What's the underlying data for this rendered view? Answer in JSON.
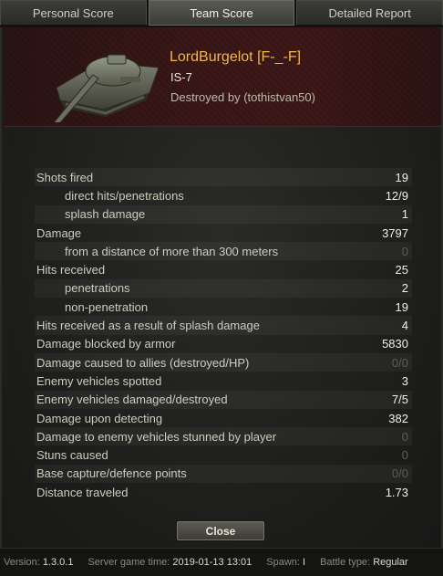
{
  "tabs": [
    {
      "label": "Personal Score",
      "active": false
    },
    {
      "label": "Team Score",
      "active": true
    },
    {
      "label": "Detailed Report",
      "active": false
    }
  ],
  "header": {
    "player_name": "LordBurgelot [F-_-F]",
    "vehicle": "IS-7",
    "destroyed_by": "Destroyed by (tothistvan50)"
  },
  "stats": [
    {
      "label": "Shots fired",
      "value": "19",
      "sub": false,
      "dim": false
    },
    {
      "label": "direct hits/penetrations",
      "value": "12/9",
      "sub": true,
      "dim": false
    },
    {
      "label": "splash damage",
      "value": "1",
      "sub": true,
      "dim": false
    },
    {
      "label": "Damage",
      "value": "3797",
      "sub": false,
      "dim": false
    },
    {
      "label": "from a distance of more than 300 meters",
      "value": "0",
      "sub": true,
      "dim": true
    },
    {
      "label": "Hits received",
      "value": "25",
      "sub": false,
      "dim": false
    },
    {
      "label": "penetrations",
      "value": "2",
      "sub": true,
      "dim": false
    },
    {
      "label": "non-penetration",
      "value": "19",
      "sub": true,
      "dim": false
    },
    {
      "label": "Hits received as a result of splash damage",
      "value": "4",
      "sub": false,
      "dim": false
    },
    {
      "label": "Damage blocked by armor",
      "value": "5830",
      "sub": false,
      "dim": false
    },
    {
      "label": "Damage caused to allies (destroyed/HP)",
      "value": "0/0",
      "sub": false,
      "dim": true
    },
    {
      "label": "Enemy vehicles spotted",
      "value": "3",
      "sub": false,
      "dim": false
    },
    {
      "label": "Enemy vehicles damaged/destroyed",
      "value": "7/5",
      "sub": false,
      "dim": false
    },
    {
      "label": "Damage upon detecting",
      "value": "382",
      "sub": false,
      "dim": false
    },
    {
      "label": "Damage to enemy vehicles stunned by player",
      "value": "0",
      "sub": false,
      "dim": true
    },
    {
      "label": "Stuns caused",
      "value": "0",
      "sub": false,
      "dim": true
    },
    {
      "label": "Base capture/defence points",
      "value": "0/0",
      "sub": false,
      "dim": true
    },
    {
      "label": "Distance traveled",
      "value": "1.73",
      "sub": false,
      "dim": false
    }
  ],
  "close_label": "Close",
  "footer": {
    "version_label": "Version:",
    "version": "1.3.0.1",
    "server_time_label": "Server game time:",
    "server_time": "2019-01-13 13:01",
    "spawn_label": "Spawn:",
    "spawn": "I",
    "battle_type_label": "Battle type:",
    "battle_type": "Regular"
  },
  "icons": {
    "tank": "tank-icon"
  },
  "colors": {
    "player_name": "#f0b84a",
    "header_bg": "#3a1717"
  }
}
